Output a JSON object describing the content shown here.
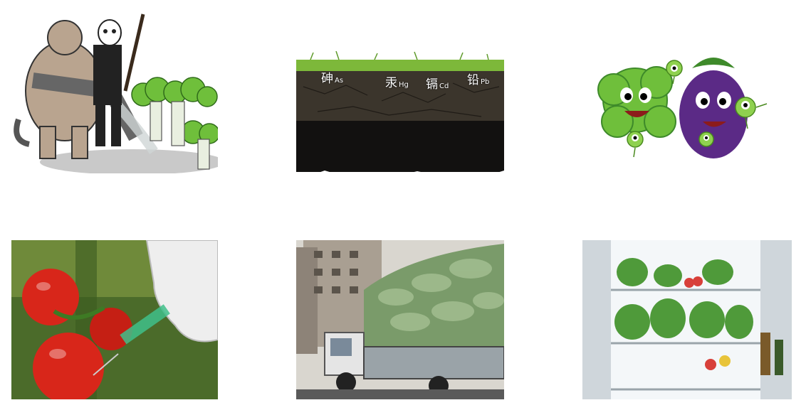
{
  "images": [
    {
      "name": "cartoon-polluter-with-pipe"
    },
    {
      "name": "soil-heavy-metals-cross-section",
      "labels": [
        {
          "cn": "砷",
          "symbol": "As"
        },
        {
          "cn": "汞",
          "symbol": "Hg"
        },
        {
          "cn": "镉",
          "symbol": "Cd"
        },
        {
          "cn": "铅",
          "symbol": "Pb"
        }
      ]
    },
    {
      "name": "cartoon-germ-vegetables"
    },
    {
      "name": "tomato-injection-photo"
    },
    {
      "name": "vegetable-truck-photo"
    },
    {
      "name": "refrigerator-vegetables-photo"
    }
  ],
  "colors": {
    "soil": "#2a251f",
    "grass": "#7db83a",
    "tomato": "#d8261a",
    "lettuce": "#6fbf3b",
    "eggplant": "#5b2a86"
  }
}
